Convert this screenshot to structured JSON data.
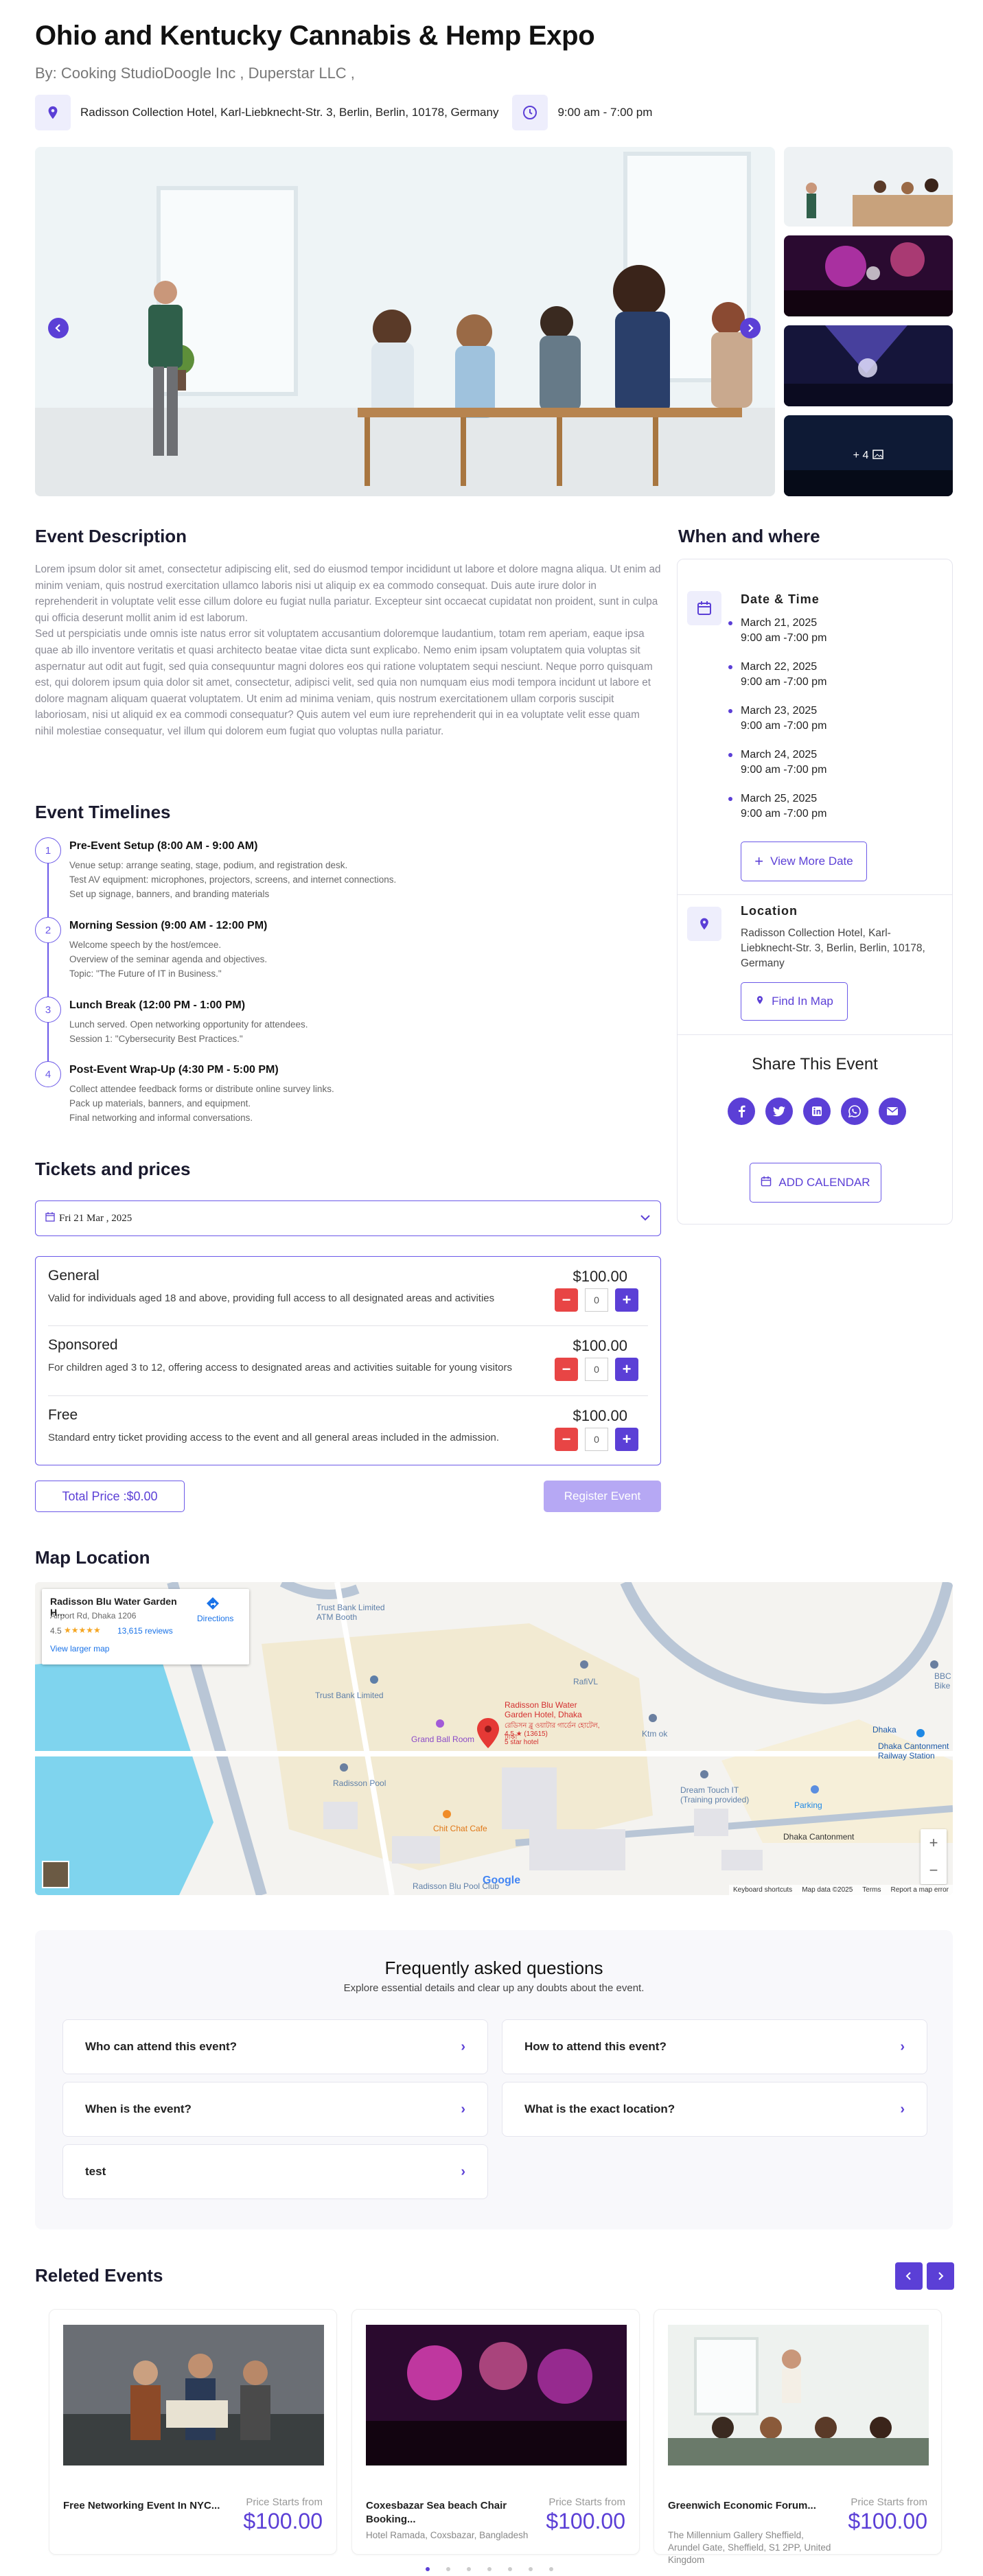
{
  "event": {
    "title": "Ohio and Kentucky Cannabis & Hemp Expo",
    "by": "By:  Cooking StudioDoogle Inc , Duperstar LLC ,",
    "address": "Radisson Collection Hotel, Karl-Liebknecht-Str. 3, Berlin, Berlin, 10178, Germany",
    "time": "9:00 am - 7:00 pm",
    "more_photos": "+ 4"
  },
  "description": {
    "title": "Event Description",
    "p1": "Lorem ipsum dolor sit amet, consectetur adipiscing elit, sed do eiusmod tempor incididunt ut labore et dolore magna aliqua. Ut enim ad minim veniam, quis nostrud exercitation ullamco laboris nisi ut aliquip ex ea commodo consequat. Duis aute irure dolor in reprehenderit in voluptate velit esse cillum dolore eu fugiat nulla pariatur. Excepteur sint occaecat cupidatat non proident, sunt in culpa qui officia deserunt mollit anim id est laborum.",
    "p2": "Sed ut perspiciatis unde omnis iste natus error sit voluptatem accusantium doloremque laudantium, totam rem aperiam, eaque ipsa quae ab illo inventore veritatis et quasi architecto beatae vitae dicta sunt explicabo. Nemo enim ipsam voluptatem quia voluptas sit aspernatur aut odit aut fugit, sed quia consequuntur magni dolores eos qui ratione voluptatem sequi nesciunt. Neque porro quisquam est, qui dolorem ipsum quia dolor sit amet, consectetur, adipisci velit, sed quia non numquam eius modi tempora incidunt ut labore et dolore magnam aliquam quaerat voluptatem. Ut enim ad minima veniam, quis nostrum exercitationem ullam corporis suscipit laboriosam, nisi ut aliquid ex ea commodi consequatur? Quis autem vel eum iure reprehenderit qui in ea voluptate velit esse quam nihil molestiae consequatur, vel illum qui dolorem eum fugiat quo voluptas nulla pariatur."
  },
  "timelines": {
    "title": "Event Timelines",
    "items": [
      {
        "num": "1",
        "title": "Pre-Event Setup (8:00 AM - 9:00 AM)",
        "lines": [
          "Venue setup: arrange seating, stage, podium, and registration desk.",
          "Test AV equipment: microphones, projectors, screens, and internet connections.",
          "Set up signage, banners, and branding materials"
        ]
      },
      {
        "num": "2",
        "title": "Morning Session (9:00 AM - 12:00 PM)",
        "lines": [
          "Welcome speech by the host/emcee.",
          "Overview of the seminar agenda and objectives.",
          "Topic: \"The Future of IT in Business.\""
        ]
      },
      {
        "num": "3",
        "title": "Lunch Break (12:00 PM - 1:00 PM)",
        "lines": [
          "Lunch served. Open networking opportunity for attendees.",
          "Session 1: \"Cybersecurity Best Practices.\""
        ]
      },
      {
        "num": "4",
        "title": "Post-Event Wrap-Up (4:30 PM - 5:00 PM)",
        "lines": [
          "Collect attendee feedback forms or distribute online survey links.",
          "Pack up materials, banners, and equipment.",
          "Final networking and informal conversations."
        ]
      }
    ]
  },
  "tickets": {
    "title": "Tickets and prices",
    "selected_date": "Fri 21 Mar , 2025",
    "items": [
      {
        "name": "General",
        "price": "$100.00",
        "desc": "Valid for individuals aged 18 and above, providing full access to all designated areas and activities",
        "qty": "0"
      },
      {
        "name": "Sponsored",
        "price": "$100.00",
        "desc": "For children aged 3 to 12, offering access to designated areas and activities suitable for young visitors",
        "qty": "0"
      },
      {
        "name": "Free",
        "price": "$100.00",
        "desc": "Standard entry ticket providing access to the event and all general areas included in the admission.",
        "qty": "0"
      }
    ],
    "total": "Total Price :$0.00",
    "register": "Register Event"
  },
  "map": {
    "title": "Map Location",
    "place_name": "Radisson Blu Water Garden H...",
    "place_addr": "Airport Rd, Dhaka 1206",
    "rating": "4.5",
    "stars": "★★★★★",
    "reviews": "13,615 reviews",
    "directions": "Directions",
    "larger": "View larger map",
    "pin_label": "Radisson Blu Water Garden Hotel, Dhaka",
    "pin_sub": "রেডিসন ব্লু ওয়াটার গার্ডেন হোটেল, ঢাকা",
    "pin_rating": "4.5 ★ (13615)",
    "pin_type": "5 star hotel",
    "labels": [
      "Trust Bank Limited ATM Booth",
      "Trust Bank Limited",
      "Grand Ball Room",
      "Radisson Pool",
      "Chit Chat Cafe",
      "RafiVL",
      "Ktm ok",
      "Dream Touch IT (Training provided)",
      "Parking",
      "Dhaka",
      "Dhaka Cantonment Railway Station",
      "Dhaka Cantonment",
      "BBC Bike",
      "Radisson Blu Pool Club"
    ],
    "footer": [
      "Keyboard shortcuts",
      "Map data ©2025",
      "Terms",
      "Report a map error"
    ],
    "google": "Google"
  },
  "faq": {
    "title": "Frequently asked questions",
    "subtitle": "Explore essential details and clear up any doubts about the event.",
    "items": [
      "Who can attend this event?",
      "How to attend this event?",
      "When is the event?",
      "What is the exact location?",
      "test"
    ]
  },
  "related": {
    "title": "Releted Events",
    "price_label": "Price Starts from",
    "items": [
      {
        "name": "Free Networking Event In NYC...",
        "addr": "",
        "price": "$100.00"
      },
      {
        "name": "Coxesbazar Sea beach Chair Booking...",
        "addr": "Hotel Ramada, Coxsbazar, Bangladesh",
        "price": "$100.00"
      },
      {
        "name": "Greenwich Economic Forum...",
        "addr": "The Millennium Gallery Sheffield, Arundel Gate, Sheffield, S1 2PP, United Kingdom",
        "price": "$100.00"
      }
    ]
  },
  "sidebar": {
    "title": "When and where",
    "date_time_label": "Date & Time",
    "dates": [
      {
        "date": "March 21, 2025",
        "time": "9:00 am -7:00 pm"
      },
      {
        "date": "March 22, 2025",
        "time": "9:00 am -7:00 pm"
      },
      {
        "date": "March 23, 2025",
        "time": "9:00 am -7:00 pm"
      },
      {
        "date": "March 24, 2025",
        "time": "9:00 am -7:00 pm"
      },
      {
        "date": "March 25, 2025",
        "time": "9:00 am -7:00 pm"
      }
    ],
    "view_more": "View More Date",
    "location_label": "Location",
    "location": "Radisson Collection Hotel, Karl-Liebknecht-Str. 3, Berlin, Berlin, 10178, Germany",
    "find_map": "Find In Map",
    "share_title": "Share This Event",
    "share_icons": [
      "facebook-icon",
      "twitter-icon",
      "linkedin-icon",
      "whatsapp-icon",
      "email-icon"
    ],
    "add_calendar": "ADD CALENDAR"
  },
  "colors": {
    "accent": "#5b3fd6",
    "minus": "#e84545"
  }
}
